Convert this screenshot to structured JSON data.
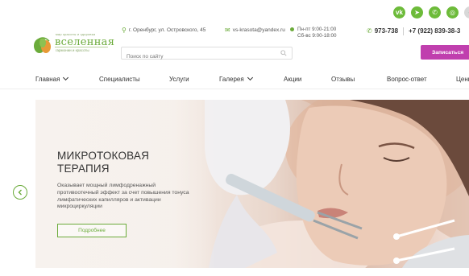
{
  "social": [
    {
      "icon": "vk-icon",
      "glyph": "vk"
    },
    {
      "icon": "telegram-icon",
      "glyph": "➤"
    },
    {
      "icon": "whatsapp-icon",
      "glyph": "✆"
    },
    {
      "icon": "instagram-icon",
      "glyph": "◎"
    },
    {
      "icon": "more-icon",
      "glyph": "●"
    }
  ],
  "logo": {
    "tagline": "мир красоты и здоровья",
    "name": "вселенная",
    "subtitle": "гармонии и красоты"
  },
  "contacts": {
    "address": "г. Оренбург, ул. Островского, 45",
    "email": "vs-krasota@yandex.ru",
    "hours_weekdays": "Пн-пт 9:00-21:00",
    "hours_weekend": "Сб-вс 9:00-18:00",
    "phone_short": "973-738",
    "phone_mobile": "+7 (922) 839-38-3"
  },
  "search": {
    "placeholder": "Поиск по сайту"
  },
  "signup_label": "Записаться",
  "nav": [
    {
      "label": "Главная",
      "dropdown": true
    },
    {
      "label": "Специалисты",
      "dropdown": false
    },
    {
      "label": "Услуги",
      "dropdown": false
    },
    {
      "label": "Галерея",
      "dropdown": true
    },
    {
      "label": "Акции",
      "dropdown": false
    },
    {
      "label": "Отзывы",
      "dropdown": false
    },
    {
      "label": "Вопрос-ответ",
      "dropdown": false
    },
    {
      "label": "Цены",
      "dropdown": false
    }
  ],
  "hero": {
    "title": "МИКРОТОКОВАЯ ТЕРАПИЯ",
    "description": "Оказывает мощный лимфодренажный противоотечный эффект за счет повышения тонуса лимфатических капилляров и активации микроциркуляции",
    "button_label": "Подробнее"
  },
  "colors": {
    "accent": "#6bab3a",
    "brand_pink": "#c03fae"
  }
}
